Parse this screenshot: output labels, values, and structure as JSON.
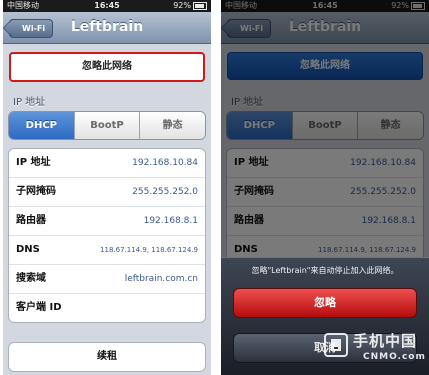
{
  "status_bar": {
    "carrier": "中国移动",
    "time": "16:45",
    "battery": "92%"
  },
  "nav": {
    "back_label": "Wi-Fi",
    "title": "Leftbrain"
  },
  "forget_network_label": "忽略此网络",
  "ip_section_label": "IP 地址",
  "segments": [
    "DHCP",
    "BootP",
    "静态"
  ],
  "selected_segment": "DHCP",
  "rows": [
    {
      "label": "IP 地址",
      "value": "192.168.10.84"
    },
    {
      "label": "子网掩码",
      "value": "255.255.252.0"
    },
    {
      "label": "路由器",
      "value": "192.168.8.1"
    },
    {
      "label": "DNS",
      "value": "118.67.114.9, 118.67.124.9"
    },
    {
      "label": "搜索域",
      "value": "leftbrain.com.cn"
    },
    {
      "label": "客户端 ID",
      "value": ""
    }
  ],
  "renew_label": "续租",
  "action_sheet": {
    "message": "忽略\"Leftbrain\"来自动停止加入此网络。",
    "ignore_label": "忽略",
    "cancel_label": "取消"
  },
  "watermark": {
    "text": "手机中国",
    "sub": "CNMO.com"
  },
  "colors": {
    "nav_bar": "#7f93ad",
    "segment_active": "#2b6ac4",
    "value_text": "#3b5a8f",
    "forget_border_highlight": "#d01a1a",
    "destructive_button": "#d42020"
  }
}
